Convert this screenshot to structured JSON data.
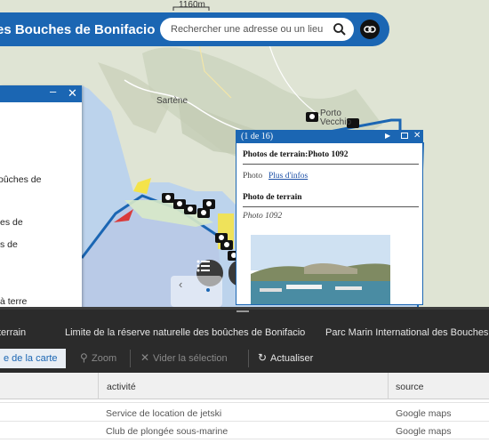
{
  "map": {
    "scale_label": "1160m",
    "places": {
      "sartene": "Sartène",
      "porto_vecchio_1": "Porto",
      "porto_vecchio_2": "Vecchio"
    }
  },
  "header": {
    "title": "es Bouches de Bonifacio",
    "search_placeholder": "Rechercher une adresse ou un lieu"
  },
  "side_panel": {
    "lines": [
      "oûches de",
      "es de",
      "s de",
      "à terre"
    ]
  },
  "popup": {
    "count": "(1 de 16)",
    "title": "Photos de terrain:Photo 1092",
    "field_label": "Photo",
    "field_link": "Plus d'infos",
    "section_title": "Photo de terrain",
    "section_value": "Photo 1092"
  },
  "tabs": [
    "terrain",
    "Limite de la réserve naturelle des boûches de Bonifacio",
    "Parc Marin International des Bouches d"
  ],
  "toolbar": {
    "filter_label": "e de la carte",
    "zoom_label": "Zoom",
    "clear_label": "Vider la sélection",
    "refresh_label": "Actualiser"
  },
  "table": {
    "columns": [
      "activité",
      "source"
    ],
    "rows": [
      {
        "activite": "Service de location de jetski",
        "source": "Google maps"
      },
      {
        "activite": "Club de plongée sous-marine",
        "source": "Google maps"
      }
    ]
  },
  "colors": {
    "accent": "#1b66b3",
    "dark_bar": "#2b2b2b",
    "zone_fill": "#b9c8e6"
  }
}
